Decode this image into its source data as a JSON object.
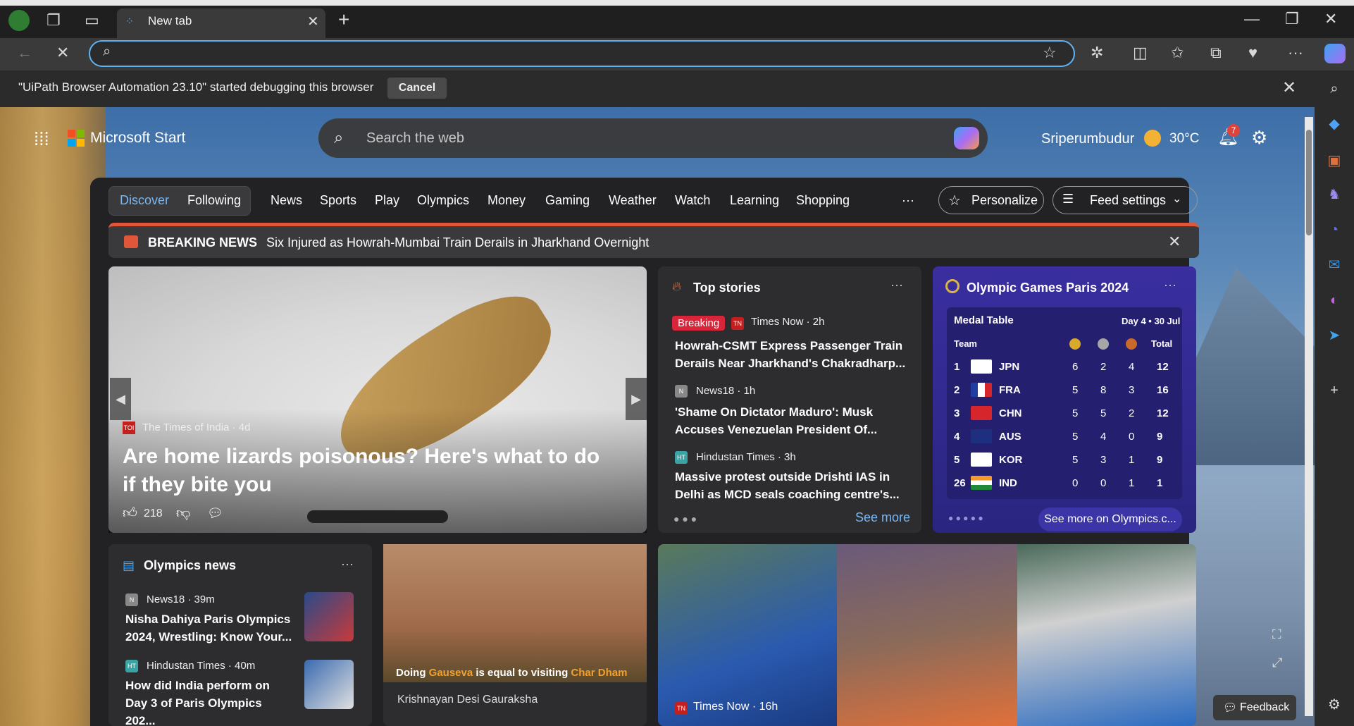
{
  "browser": {
    "tab_title": "New tab",
    "address_value": "",
    "infobar_text": "\"UiPath Browser Automation 23.10\" started debugging this browser",
    "cancel_label": "Cancel",
    "feedback_label": "Feedback"
  },
  "header": {
    "brand": "Microsoft Start",
    "search_placeholder": "Search the web",
    "location": "Sriperumbudur",
    "temperature": "30°C",
    "notification_count": "7"
  },
  "nav": {
    "tabs": [
      "Discover",
      "Following"
    ],
    "items": [
      "News",
      "Sports",
      "Play",
      "Olympics",
      "Money",
      "Gaming",
      "Weather",
      "Watch",
      "Learning",
      "Shopping"
    ],
    "more": "···",
    "personalize": "Personalize",
    "feed_settings": "Feed settings"
  },
  "breaking": {
    "label": "BREAKING NEWS",
    "text": "Six Injured as Howrah-Mumbai Train Derails in Jharkhand Overnight"
  },
  "hero": {
    "source": "The Times of India · 4d",
    "title": "Are home lizards poisonous? Here's what to do if they bite you",
    "likes": "218"
  },
  "top_stories": {
    "title": "Top stories",
    "items": [
      {
        "badge": "Breaking",
        "source": "Times Now · 2h",
        "headline": "Howrah-CSMT Express Passenger Train Derails Near Jharkhand's Chakradharp..."
      },
      {
        "source": "News18 · 1h",
        "headline": "'Shame On Dictator Maduro': Musk Accuses Venezuelan President Of..."
      },
      {
        "source": "Hindustan Times · 3h",
        "headline": "Massive protest outside Drishti IAS in Delhi as MCD seals coaching centre's..."
      }
    ],
    "see_more": "See more"
  },
  "olympics": {
    "title": "Olympic Games Paris 2024",
    "table_title": "Medal Table",
    "day": "Day 4 • 30 Jul",
    "headers": [
      "Team",
      "Total"
    ],
    "rows": [
      {
        "rank": "1",
        "team": "JPN",
        "g": "6",
        "s": "2",
        "b": "4",
        "total": "12"
      },
      {
        "rank": "2",
        "team": "FRA",
        "g": "5",
        "s": "8",
        "b": "3",
        "total": "16"
      },
      {
        "rank": "3",
        "team": "CHN",
        "g": "5",
        "s": "5",
        "b": "2",
        "total": "12"
      },
      {
        "rank": "4",
        "team": "AUS",
        "g": "5",
        "s": "4",
        "b": "0",
        "total": "9"
      },
      {
        "rank": "5",
        "team": "KOR",
        "g": "5",
        "s": "3",
        "b": "1",
        "total": "9"
      },
      {
        "rank": "26",
        "team": "IND",
        "g": "0",
        "s": "0",
        "b": "1",
        "total": "1"
      }
    ],
    "button": "See more on Olympics.c..."
  },
  "olympics_news": {
    "title": "Olympics news",
    "items": [
      {
        "source": "News18 · 39m",
        "headline": "Nisha Dahiya Paris Olympics 2024, Wrestling: Know Your..."
      },
      {
        "source": "Hindustan Times · 40m",
        "headline": "How did India perform on Day 3 of Paris Olympics 202..."
      }
    ]
  },
  "cow_card": {
    "caption_pre": "Doing ",
    "caption_hl1": "Gauseva",
    "caption_mid": " is equal to visiting ",
    "caption_hl2": "Char Dham",
    "source": "Krishnayan Desi Gauraksha"
  },
  "cricket_card": {
    "source": "Times Now · 16h"
  },
  "colors": {
    "accent": "#79b8f2",
    "breaking_red": "#d8253a",
    "olympic_purple": "#3a2ea0"
  }
}
